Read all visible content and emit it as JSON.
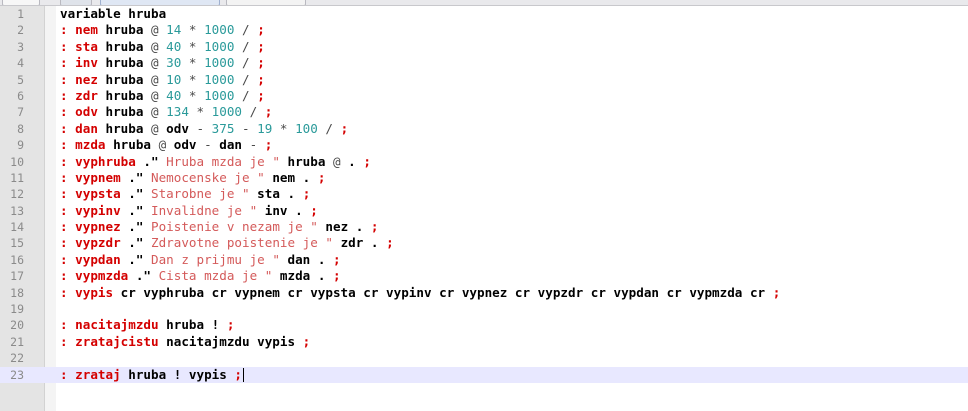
{
  "colors": {
    "word": "#000000",
    "definition": "#d40000",
    "number": "#2a9a9a",
    "operator": "#4a4a4a",
    "string": "#d45a5a",
    "current_line": "#e8e8ff",
    "gutter": "#e4e4e4"
  },
  "editor": {
    "current_line": 23,
    "lines": [
      {
        "n": "1",
        "tokens": [
          {
            "t": "variable hruba",
            "c": "wd"
          }
        ]
      },
      {
        "n": "2",
        "tokens": [
          {
            "t": ": nem",
            "c": "kw"
          },
          {
            "t": " hruba ",
            "c": "wd"
          },
          {
            "t": "@ ",
            "c": "op"
          },
          {
            "t": "14",
            "c": "num"
          },
          {
            "t": " * ",
            "c": "op"
          },
          {
            "t": "1000",
            "c": "num"
          },
          {
            "t": " / ",
            "c": "op"
          },
          {
            "t": ";",
            "c": "kw"
          }
        ]
      },
      {
        "n": "3",
        "tokens": [
          {
            "t": ": sta",
            "c": "kw"
          },
          {
            "t": " hruba ",
            "c": "wd"
          },
          {
            "t": "@ ",
            "c": "op"
          },
          {
            "t": "40",
            "c": "num"
          },
          {
            "t": " * ",
            "c": "op"
          },
          {
            "t": "1000",
            "c": "num"
          },
          {
            "t": " / ",
            "c": "op"
          },
          {
            "t": ";",
            "c": "kw"
          }
        ]
      },
      {
        "n": "4",
        "tokens": [
          {
            "t": ": inv",
            "c": "kw"
          },
          {
            "t": " hruba ",
            "c": "wd"
          },
          {
            "t": "@ ",
            "c": "op"
          },
          {
            "t": "30",
            "c": "num"
          },
          {
            "t": " * ",
            "c": "op"
          },
          {
            "t": "1000",
            "c": "num"
          },
          {
            "t": " / ",
            "c": "op"
          },
          {
            "t": ";",
            "c": "kw"
          }
        ]
      },
      {
        "n": "5",
        "tokens": [
          {
            "t": ": nez",
            "c": "kw"
          },
          {
            "t": " hruba ",
            "c": "wd"
          },
          {
            "t": "@ ",
            "c": "op"
          },
          {
            "t": "10",
            "c": "num"
          },
          {
            "t": " * ",
            "c": "op"
          },
          {
            "t": "1000",
            "c": "num"
          },
          {
            "t": " / ",
            "c": "op"
          },
          {
            "t": ";",
            "c": "kw"
          }
        ]
      },
      {
        "n": "6",
        "tokens": [
          {
            "t": ": zdr",
            "c": "kw"
          },
          {
            "t": " hruba ",
            "c": "wd"
          },
          {
            "t": "@ ",
            "c": "op"
          },
          {
            "t": "40",
            "c": "num"
          },
          {
            "t": " * ",
            "c": "op"
          },
          {
            "t": "1000",
            "c": "num"
          },
          {
            "t": " / ",
            "c": "op"
          },
          {
            "t": ";",
            "c": "kw"
          }
        ]
      },
      {
        "n": "7",
        "tokens": [
          {
            "t": ": odv",
            "c": "kw"
          },
          {
            "t": " hruba ",
            "c": "wd"
          },
          {
            "t": "@ ",
            "c": "op"
          },
          {
            "t": "134",
            "c": "num"
          },
          {
            "t": " * ",
            "c": "op"
          },
          {
            "t": "1000",
            "c": "num"
          },
          {
            "t": " / ",
            "c": "op"
          },
          {
            "t": ";",
            "c": "kw"
          }
        ]
      },
      {
        "n": "8",
        "tokens": [
          {
            "t": ": dan",
            "c": "kw"
          },
          {
            "t": " hruba ",
            "c": "wd"
          },
          {
            "t": "@ ",
            "c": "op"
          },
          {
            "t": "odv",
            "c": "wd"
          },
          {
            "t": " - ",
            "c": "op"
          },
          {
            "t": "375",
            "c": "num"
          },
          {
            "t": " - ",
            "c": "op"
          },
          {
            "t": "19",
            "c": "num"
          },
          {
            "t": " * ",
            "c": "op"
          },
          {
            "t": "100",
            "c": "num"
          },
          {
            "t": " / ",
            "c": "op"
          },
          {
            "t": ";",
            "c": "kw"
          }
        ]
      },
      {
        "n": "9",
        "tokens": [
          {
            "t": ": mzda",
            "c": "kw"
          },
          {
            "t": " hruba ",
            "c": "wd"
          },
          {
            "t": "@ ",
            "c": "op"
          },
          {
            "t": "odv",
            "c": "wd"
          },
          {
            "t": " - ",
            "c": "op"
          },
          {
            "t": "dan",
            "c": "wd"
          },
          {
            "t": " - ",
            "c": "op"
          },
          {
            "t": ";",
            "c": "kw"
          }
        ]
      },
      {
        "n": "10",
        "tokens": [
          {
            "t": ": vyphruba",
            "c": "kw"
          },
          {
            "t": " .\" ",
            "c": "wd"
          },
          {
            "t": "Hruba mzda je \"",
            "c": "str"
          },
          {
            "t": " hruba ",
            "c": "wd"
          },
          {
            "t": "@ ",
            "c": "op"
          },
          {
            "t": ". ",
            "c": "wd"
          },
          {
            "t": ";",
            "c": "kw"
          }
        ]
      },
      {
        "n": "11",
        "tokens": [
          {
            "t": ": vypnem",
            "c": "kw"
          },
          {
            "t": " .\" ",
            "c": "wd"
          },
          {
            "t": "Nemocenske je \"",
            "c": "str"
          },
          {
            "t": " nem ",
            "c": "wd"
          },
          {
            "t": ". ",
            "c": "wd"
          },
          {
            "t": ";",
            "c": "kw"
          }
        ]
      },
      {
        "n": "12",
        "tokens": [
          {
            "t": ": vypsta",
            "c": "kw"
          },
          {
            "t": " .\" ",
            "c": "wd"
          },
          {
            "t": "Starobne je \"",
            "c": "str"
          },
          {
            "t": " sta ",
            "c": "wd"
          },
          {
            "t": ". ",
            "c": "wd"
          },
          {
            "t": ";",
            "c": "kw"
          }
        ]
      },
      {
        "n": "13",
        "tokens": [
          {
            "t": ": vypinv",
            "c": "kw"
          },
          {
            "t": " .\" ",
            "c": "wd"
          },
          {
            "t": "Invalidne je \"",
            "c": "str"
          },
          {
            "t": " inv ",
            "c": "wd"
          },
          {
            "t": ". ",
            "c": "wd"
          },
          {
            "t": ";",
            "c": "kw"
          }
        ]
      },
      {
        "n": "14",
        "tokens": [
          {
            "t": ": vypnez",
            "c": "kw"
          },
          {
            "t": " .\" ",
            "c": "wd"
          },
          {
            "t": "Poistenie v nezam je \"",
            "c": "str"
          },
          {
            "t": " nez ",
            "c": "wd"
          },
          {
            "t": ". ",
            "c": "wd"
          },
          {
            "t": ";",
            "c": "kw"
          }
        ]
      },
      {
        "n": "15",
        "tokens": [
          {
            "t": ": vypzdr",
            "c": "kw"
          },
          {
            "t": " .\" ",
            "c": "wd"
          },
          {
            "t": "Zdravotne poistenie je \"",
            "c": "str"
          },
          {
            "t": " zdr ",
            "c": "wd"
          },
          {
            "t": ". ",
            "c": "wd"
          },
          {
            "t": ";",
            "c": "kw"
          }
        ]
      },
      {
        "n": "16",
        "tokens": [
          {
            "t": ": vypdan",
            "c": "kw"
          },
          {
            "t": " .\" ",
            "c": "wd"
          },
          {
            "t": "Dan z prijmu je \"",
            "c": "str"
          },
          {
            "t": " dan ",
            "c": "wd"
          },
          {
            "t": ". ",
            "c": "wd"
          },
          {
            "t": ";",
            "c": "kw"
          }
        ]
      },
      {
        "n": "17",
        "tokens": [
          {
            "t": ": vypmzda",
            "c": "kw"
          },
          {
            "t": " .\" ",
            "c": "wd"
          },
          {
            "t": "Cista mzda je \"",
            "c": "str"
          },
          {
            "t": " mzda ",
            "c": "wd"
          },
          {
            "t": ". ",
            "c": "wd"
          },
          {
            "t": ";",
            "c": "kw"
          }
        ]
      },
      {
        "n": "18",
        "tokens": [
          {
            "t": ": vypis",
            "c": "kw"
          },
          {
            "t": " cr vyphruba cr vypnem cr vypsta cr vypinv cr vypnez cr vypzdr cr vypdan cr vypmzda cr ",
            "c": "wd"
          },
          {
            "t": ";",
            "c": "kw"
          }
        ]
      },
      {
        "n": "19",
        "tokens": []
      },
      {
        "n": "20",
        "tokens": [
          {
            "t": ": nacitajmzdu",
            "c": "kw"
          },
          {
            "t": " hruba ! ",
            "c": "wd"
          },
          {
            "t": ";",
            "c": "kw"
          }
        ]
      },
      {
        "n": "21",
        "tokens": [
          {
            "t": ": zratajcistu",
            "c": "kw"
          },
          {
            "t": " nacitajmzdu vypis ",
            "c": "wd"
          },
          {
            "t": ";",
            "c": "kw"
          }
        ]
      },
      {
        "n": "22",
        "tokens": []
      },
      {
        "n": "23",
        "tokens": [
          {
            "t": ": zrataj",
            "c": "kw"
          },
          {
            "t": " hruba ! vypis ",
            "c": "wd"
          },
          {
            "t": ";",
            "c": "kw"
          }
        ]
      }
    ]
  }
}
